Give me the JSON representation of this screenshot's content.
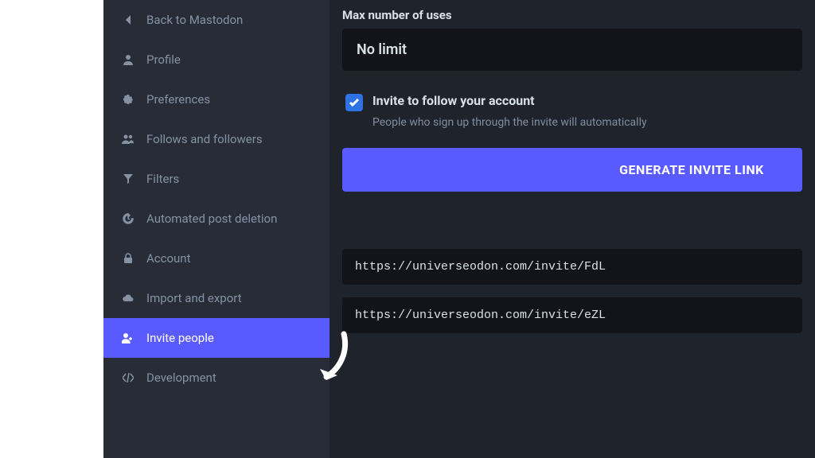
{
  "sidebar": {
    "items": [
      {
        "label": "Back to Mastodon",
        "icon": "chevron-left"
      },
      {
        "label": "Profile",
        "icon": "user"
      },
      {
        "label": "Preferences",
        "icon": "gear"
      },
      {
        "label": "Follows and followers",
        "icon": "users"
      },
      {
        "label": "Filters",
        "icon": "filter"
      },
      {
        "label": "Automated post deletion",
        "icon": "history"
      },
      {
        "label": "Account",
        "icon": "lock"
      },
      {
        "label": "Import and export",
        "icon": "cloud"
      },
      {
        "label": "Invite people",
        "icon": "user-plus",
        "active": true
      },
      {
        "label": "Development",
        "icon": "code"
      }
    ]
  },
  "main": {
    "max_uses_label": "Max number of uses",
    "max_uses_value": "No limit",
    "invite_follow_label": "Invite to follow your account",
    "invite_follow_help": "People who sign up through the invite will automatically",
    "generate_label": "GENERATE INVITE LINK",
    "invites": [
      "https://universeodon.com/invite/FdL",
      "https://universeodon.com/invite/eZL"
    ]
  }
}
